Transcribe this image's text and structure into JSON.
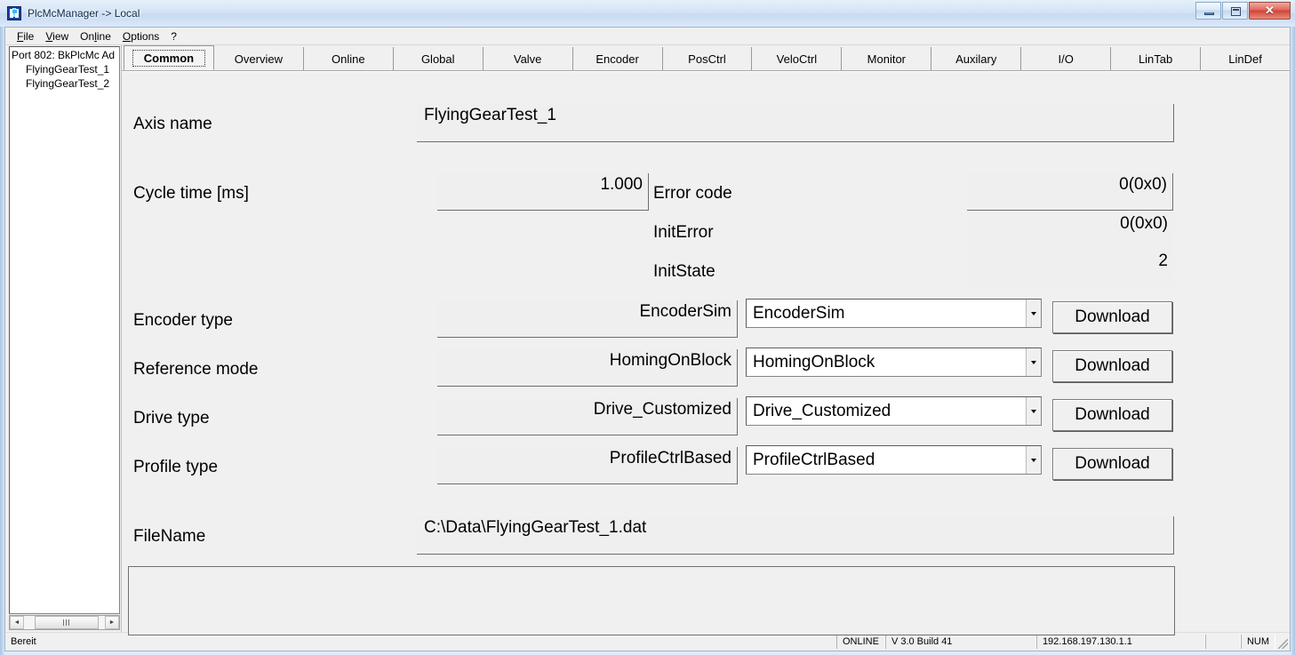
{
  "window": {
    "title": "PlcMcManager -> Local",
    "icon": "app-icon",
    "minimize_label": "",
    "maximize_label": "",
    "close_label": "✕"
  },
  "menubar": {
    "items": [
      {
        "label": "File",
        "accel": "F"
      },
      {
        "label": "View",
        "accel": "V"
      },
      {
        "label": "Online",
        "accel": "l"
      },
      {
        "label": "Options",
        "accel": "O"
      },
      {
        "label": "?",
        "accel": ""
      }
    ]
  },
  "sidebar": {
    "tree": [
      {
        "label": "Port 802: BkPlcMc Ad",
        "level": 0
      },
      {
        "label": "FlyingGearTest_1",
        "level": 1
      },
      {
        "label": "FlyingGearTest_2",
        "level": 1
      }
    ],
    "scrollbar": {
      "left_arrow": "◄",
      "right_arrow": "►"
    }
  },
  "tabs": {
    "active_index": 0,
    "items": [
      {
        "label": "Common"
      },
      {
        "label": "Overview"
      },
      {
        "label": "Online"
      },
      {
        "label": "Global"
      },
      {
        "label": "Valve"
      },
      {
        "label": "Encoder"
      },
      {
        "label": "PosCtrl"
      },
      {
        "label": "VeloCtrl"
      },
      {
        "label": "Monitor"
      },
      {
        "label": "Auxilary"
      },
      {
        "label": "I/O"
      },
      {
        "label": "LinTab"
      },
      {
        "label": "LinDef"
      }
    ]
  },
  "form": {
    "axis_name": {
      "label": "Axis name",
      "value": "FlyingGearTest_1"
    },
    "cycle_time": {
      "label": "Cycle time [ms]",
      "value": "1.000"
    },
    "error_code": {
      "label": "Error code",
      "value": "0(0x0)"
    },
    "init_error": {
      "label": "InitError",
      "value": "0(0x0)"
    },
    "init_state": {
      "label": "InitState",
      "value": "2"
    },
    "encoder_type": {
      "label": "Encoder type",
      "current": "EncoderSim",
      "selected": "EncoderSim",
      "button": "Download"
    },
    "reference_mode": {
      "label": "Reference mode",
      "current": "HomingOnBlock",
      "selected": "HomingOnBlock",
      "button": "Download"
    },
    "drive_type": {
      "label": "Drive type",
      "current": "Drive_Customized",
      "selected": "Drive_Customized",
      "button": "Download"
    },
    "profile_type": {
      "label": "Profile type",
      "current": "ProfileCtrlBased",
      "selected": "ProfileCtrlBased",
      "button": "Download"
    },
    "file_name": {
      "label": "FileName",
      "value": "C:\\Data\\FlyingGearTest_1.dat"
    }
  },
  "statusbar": {
    "message": "Bereit",
    "connection": "ONLINE",
    "version": "V 3.0 Build 41",
    "address": "192.168.197.130.1.1",
    "num_lock": "NUM"
  }
}
